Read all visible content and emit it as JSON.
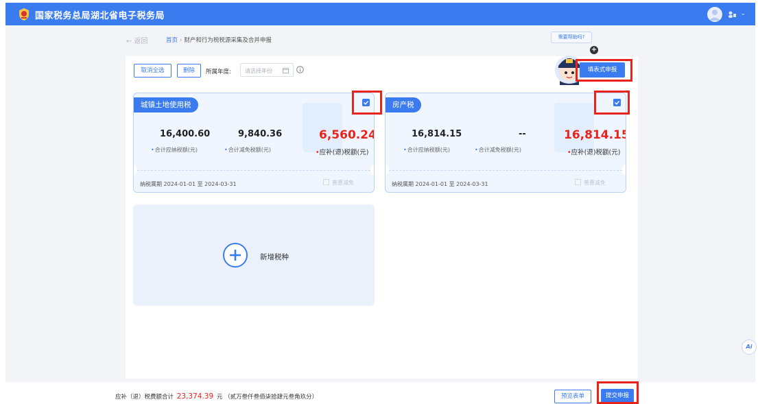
{
  "header": {
    "brand": "国家税务总局湖北省电子税务局",
    "logo_icon": "tax-emblem-icon",
    "user_icon": "user-avatar-icon",
    "color": "#3a7bf0"
  },
  "nav": {
    "back_label": "← 返回",
    "breadcrumb_home": "首页",
    "breadcrumb_separator": "›",
    "breadcrumb_current": "财产和行为税税源采集及合并申报"
  },
  "assistant": {
    "help_text": "需要帮助吗?",
    "plus_label": "+"
  },
  "toolbar": {
    "cancel_all_label": "取消全选",
    "delete_label": "删除",
    "year_label": "所属年度:",
    "year_placeholder": "请选择年份",
    "form_declare_label": "填表式申报"
  },
  "cards": [
    {
      "tag": "城镇土地使用税",
      "total_payable": "16,400.60",
      "total_payable_label": "合计应纳税额(元)",
      "total_relief": "9,840.36",
      "total_relief_label": "合计减免税额(元)",
      "refund_amount": "6,560.24",
      "refund_label": "应补(退)税额(元)",
      "period": "纳税属期 2024-01-01 至 2024-03-31",
      "relief_option": "普惠减免",
      "checked": true
    },
    {
      "tag": "房产税",
      "total_payable": "16,814.15",
      "total_payable_label": "合计应纳税额(元)",
      "total_relief": "--",
      "total_relief_label": "合计减免税额(元)",
      "refund_amount": "16,814.15",
      "refund_label": "应补(退)税额(元)",
      "period": "纳税属期 2024-01-01 至 2024-03-31",
      "relief_option": "普惠减免",
      "checked": true
    }
  ],
  "add_card": {
    "label": "新增税种",
    "icon": "plus-circle-icon"
  },
  "ai_button": {
    "label": "Ai"
  },
  "footer": {
    "total_prefix": "应补（退）税费额合计",
    "total_amount": "23,374.39",
    "total_unit": "元",
    "total_in_words": "（贰万叁仟叁佰柒拾肆元叁角玖分）",
    "preview_label": "预览表单",
    "submit_label": "提交申报"
  },
  "colors": {
    "primary": "#3a7bf0",
    "highlight_red": "#e8231b",
    "card_bg": "#f0f6ff"
  }
}
